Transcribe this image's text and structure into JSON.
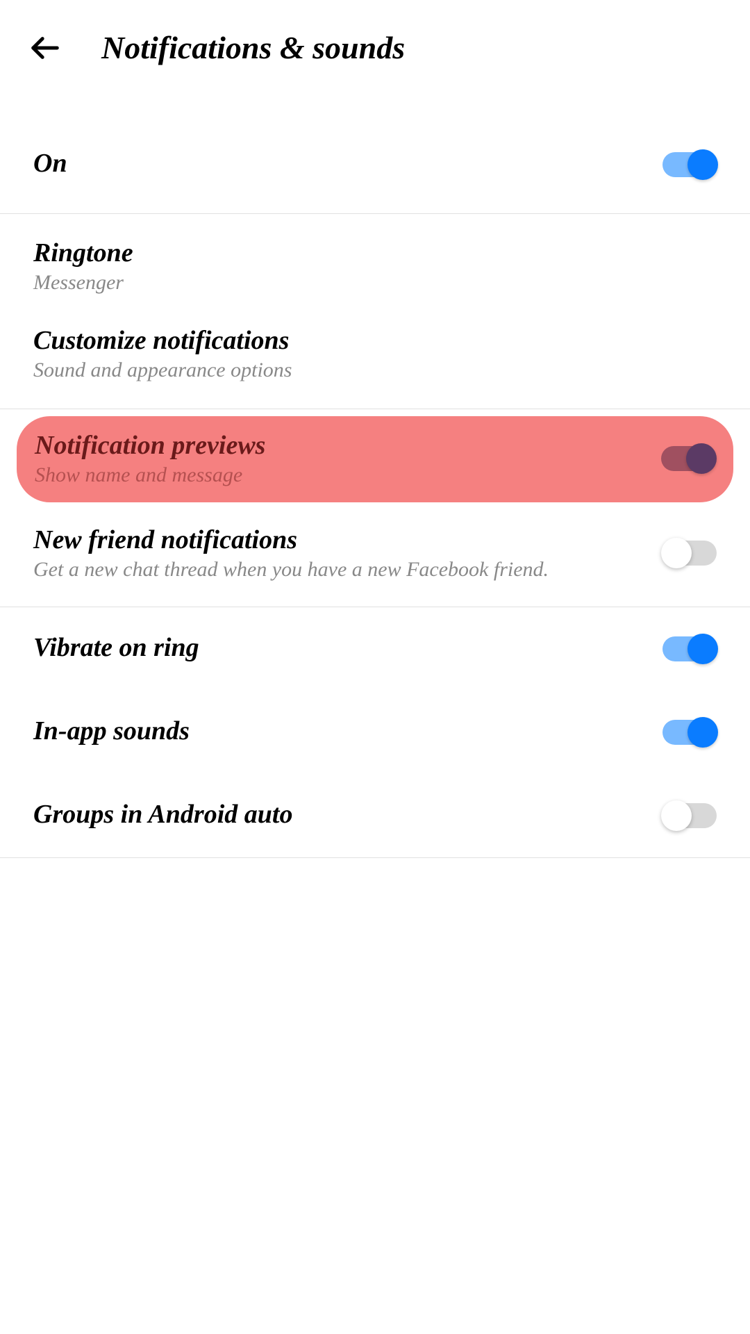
{
  "header": {
    "title": "Notifications & sounds"
  },
  "sections": [
    {
      "rows": [
        {
          "title": "On",
          "subtitle": "",
          "toggle": true,
          "toggle_state": "on"
        }
      ]
    },
    {
      "rows": [
        {
          "title": "Ringtone",
          "subtitle": "Messenger",
          "toggle": false
        },
        {
          "title": "Customize notifications",
          "subtitle": "Sound and appearance options",
          "toggle": false
        }
      ]
    },
    {
      "rows": [
        {
          "title": "Notification previews",
          "subtitle": "Show name and message",
          "toggle": true,
          "toggle_state": "on",
          "highlighted": true
        },
        {
          "title": "New friend notifications",
          "subtitle": "Get a new chat thread when you have a new Facebook friend.",
          "toggle": true,
          "toggle_state": "off"
        }
      ]
    },
    {
      "rows": [
        {
          "title": "Vibrate on ring",
          "subtitle": "",
          "toggle": true,
          "toggle_state": "on"
        },
        {
          "title": "In-app sounds",
          "subtitle": "",
          "toggle": true,
          "toggle_state": "on"
        },
        {
          "title": "Groups in Android auto",
          "subtitle": "",
          "toggle": true,
          "toggle_state": "off"
        }
      ]
    }
  ]
}
